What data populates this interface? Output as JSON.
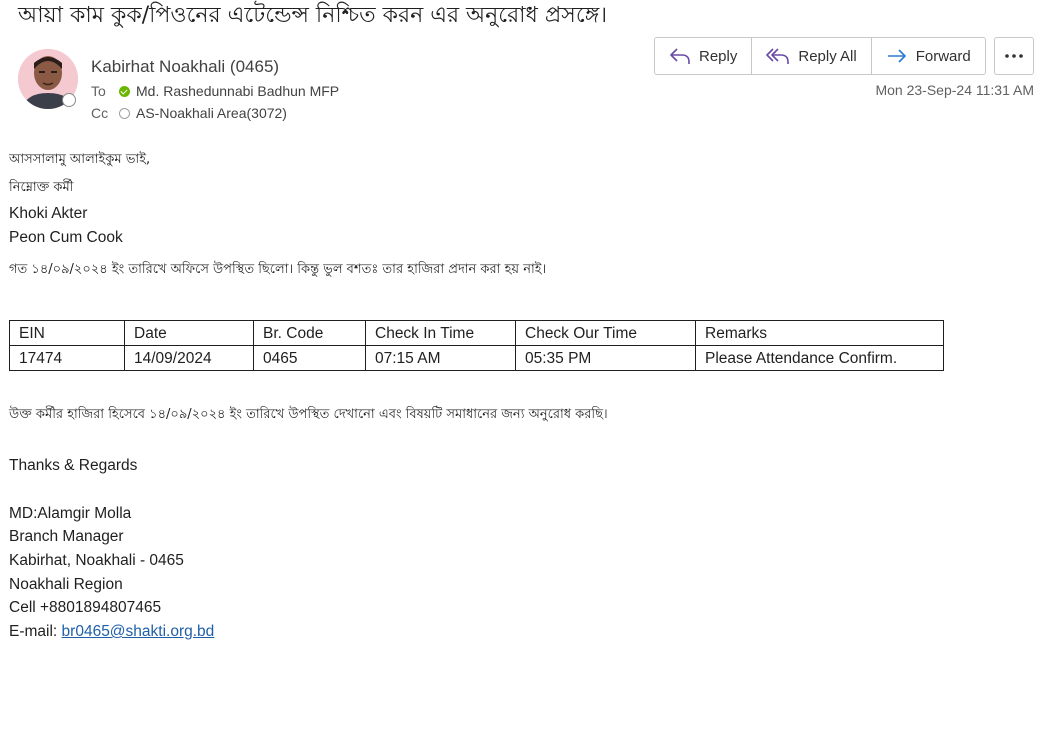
{
  "subject": "আয়া কাম কুক/পিওনের এটেন্ডেন্স নিশ্চিত করন এর অনুরোধ প্রসঙ্গে।",
  "header": {
    "sender": "Kabirhat Noakhali (0465)",
    "to_label": "To",
    "to_name": "Md. Rashedunnabi Badhun MFP",
    "cc_label": "Cc",
    "cc_name": "AS-Noakhali Area(3072)",
    "datetime": "Mon 23-Sep-24 11:31 AM"
  },
  "actions": {
    "reply": "Reply",
    "reply_all": "Reply All",
    "forward": "Forward"
  },
  "body": {
    "greeting": "আসসালামু আলাইকুম ভাই,",
    "line2": "নিম্নোক্ত কর্মী",
    "employee_name": "Khoki Akter",
    "employee_role": "Peon Cum Cook",
    "line5": "গত ১৪/০৯/২০২৪ ইং তারিখে অফিসে উপস্থিত ছিলো। কিন্তু ভুল বশতঃ তার হাজিরা প্রদান করা হয় নাই।",
    "table": {
      "headers": [
        "EIN",
        "Date",
        "Br.  Code",
        "Check In Time",
        "Check Our Time",
        "Remarks"
      ],
      "rows": [
        [
          "17474",
          "14/09/2024",
          "0465",
          "07:15 AM",
          "05:35 PM",
          "Please Attendance Confirm."
        ]
      ]
    },
    "request_line": "উক্ত কর্মীর হাজিরা হিসেবে ১৪/০৯/২০২৪ ইং তারিখে উপস্থিত দেখানো এবং বিষয়টি সমাধানের জন্য অনুরোধ করছি।",
    "closing": "Thanks & Regards",
    "sig_name": "MD:Alamgir Molla",
    "sig_title": "Branch Manager",
    "sig_branch": "Kabirhat, Noakhali - 0465",
    "sig_region": "Noakhali Region",
    "sig_cell": "Cell +8801894807465",
    "sig_email_label": "E-mail: ",
    "sig_email": "br0465@shakti.org.bd"
  },
  "colors": {
    "presence_available": "#6bb700",
    "link": "#1f5fa8",
    "avatar_bg": "#f4c9cf"
  },
  "icons": {
    "reply": "reply-icon",
    "reply_all": "reply-all-icon",
    "forward": "forward-icon",
    "more": "more-options-icon"
  }
}
